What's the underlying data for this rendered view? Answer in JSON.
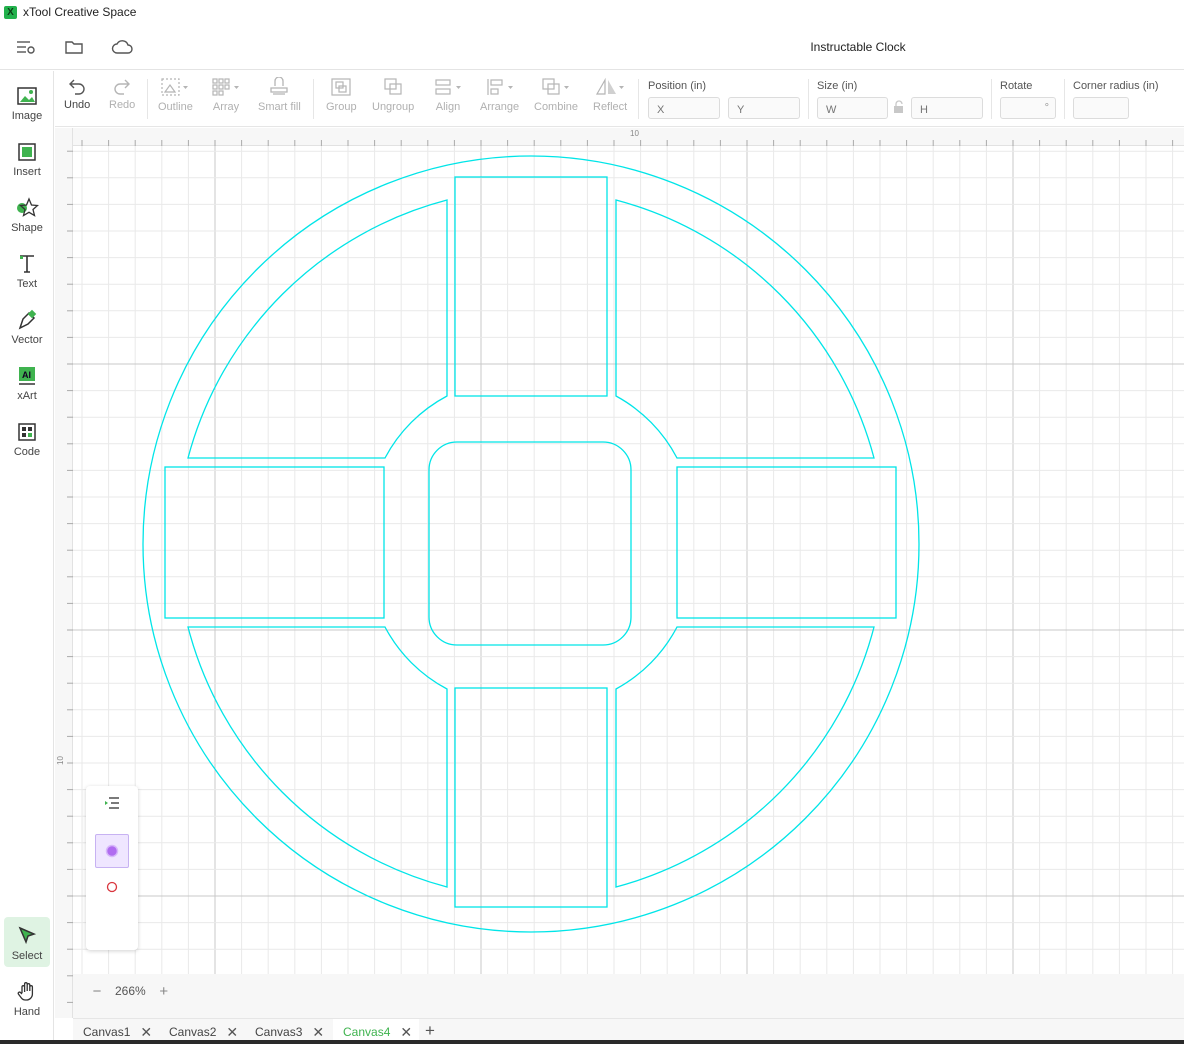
{
  "app": {
    "title": "xTool Creative Space",
    "logo_glyph": "X"
  },
  "menubar": {
    "icons": [
      "menu-icon",
      "folder-icon",
      "cloud-icon"
    ],
    "document_title": "Instructable Clock"
  },
  "left_tools": [
    {
      "label": "Image",
      "icon": "image-icon"
    },
    {
      "label": "Insert",
      "icon": "insert-icon"
    },
    {
      "label": "Shape",
      "icon": "shape-icon"
    },
    {
      "label": "Text",
      "icon": "text-icon"
    },
    {
      "label": "Vector",
      "icon": "pen-icon"
    },
    {
      "label": "xArt",
      "icon": "ai-icon"
    },
    {
      "label": "Code",
      "icon": "qr-code-icon"
    },
    {
      "label": "Select",
      "icon": "cursor-icon",
      "active": true
    },
    {
      "label": "Hand",
      "icon": "hand-icon"
    }
  ],
  "toolbar": {
    "undo": "Undo",
    "redo": "Redo",
    "outline": "Outline",
    "array": "Array",
    "smart_fill": "Smart fill",
    "group": "Group",
    "ungroup": "Ungroup",
    "align": "Align",
    "arrange": "Arrange",
    "combine": "Combine",
    "reflect": "Reflect",
    "position_label": "Position (in)",
    "x_placeholder": "X",
    "y_placeholder": "Y",
    "size_label": "Size (in)",
    "w_placeholder": "W",
    "h_placeholder": "H",
    "rotate_label": "Rotate",
    "rotate_unit": "°",
    "corner_label": "Corner radius (in)"
  },
  "ruler": {
    "top_mark": "10",
    "left_mark": "10"
  },
  "zoom": {
    "minus": "−",
    "value": "266%",
    "plus": "+"
  },
  "layers": {
    "list_icon": "layer-list-icon",
    "items": [
      "engrave-layer-icon",
      "cut-layer-icon"
    ]
  },
  "tabs": [
    {
      "label": "Canvas1",
      "active": false
    },
    {
      "label": "Canvas2",
      "active": false
    },
    {
      "label": "Canvas3",
      "active": false
    },
    {
      "label": "Canvas4",
      "active": true
    }
  ],
  "add_tab": "+",
  "colors": {
    "accent": "#3fb34f",
    "path": "#00e5e8",
    "grid": "#e9e9e9",
    "grid_major": "#c8c8c8"
  }
}
